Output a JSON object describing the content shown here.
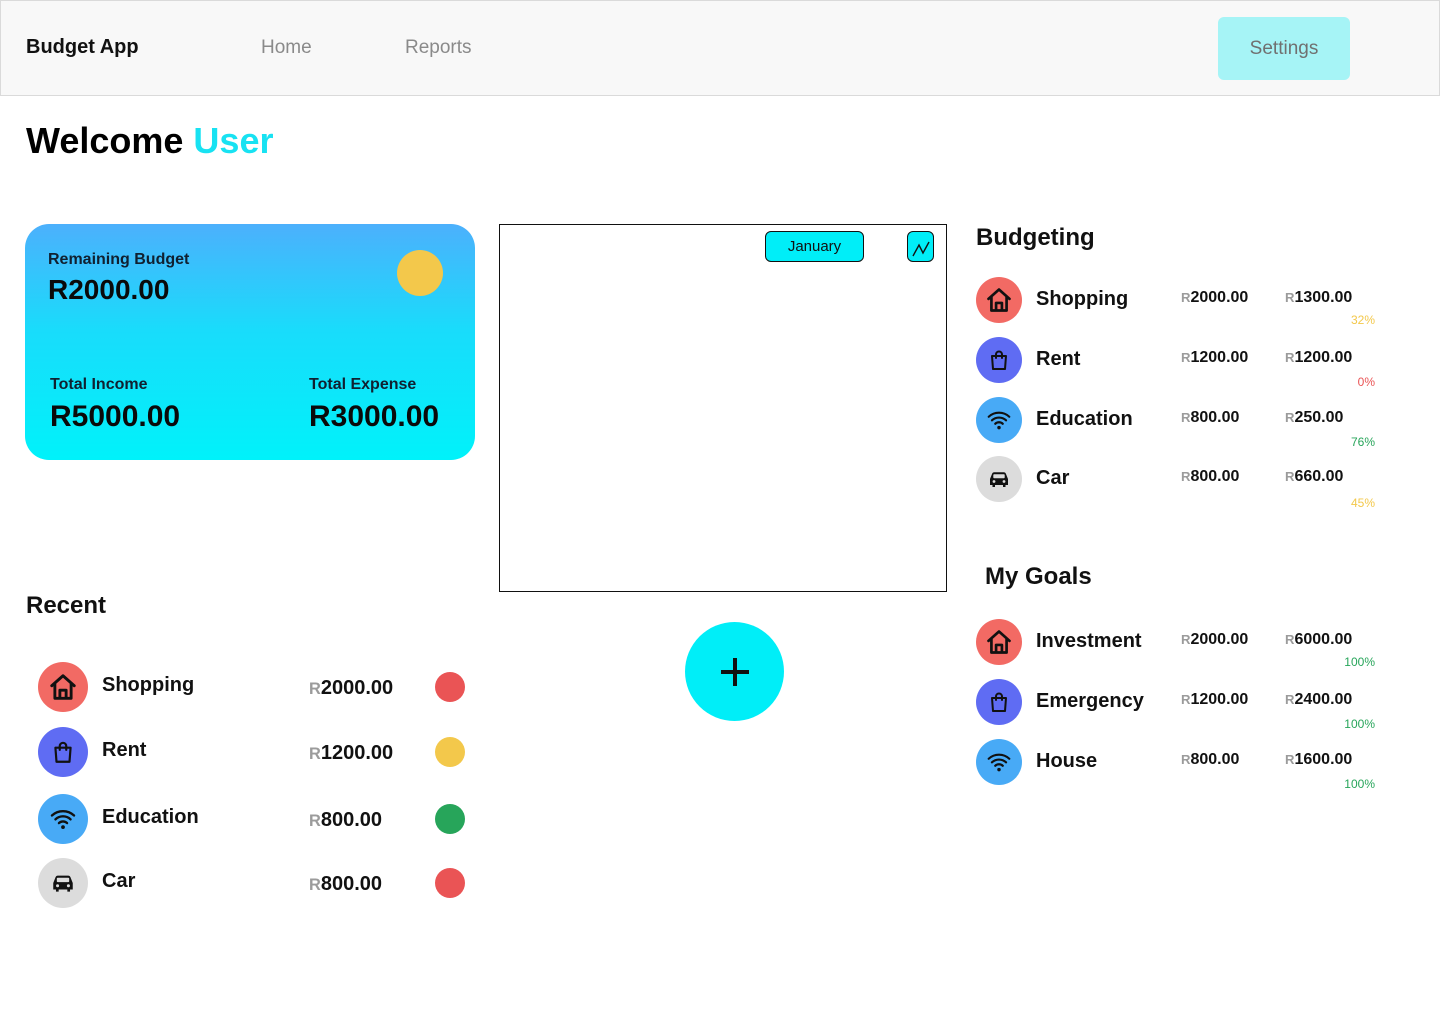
{
  "nav": {
    "brand": "Budget App",
    "links": [
      "Home",
      "Reports"
    ],
    "settings_label": "Settings"
  },
  "welcome": {
    "greeting": "Welcome",
    "user": "User"
  },
  "balance": {
    "remaining_label": "Remaining Budget",
    "remaining_value": "R2000.00",
    "income_label": "Total Income",
    "income_value": "R5000.00",
    "expense_label": "Total Expense",
    "expense_value": "R3000.00"
  },
  "chart_panel": {
    "month": "January"
  },
  "recent": {
    "title": "Recent",
    "items": [
      {
        "name": "Shopping",
        "currency": "R",
        "amount": "2000.00",
        "icon": "house-icon",
        "icon_color": "#f26a64",
        "status_color": "#ea5455"
      },
      {
        "name": "Rent",
        "currency": "R",
        "amount": "1200.00",
        "icon": "shopping-bag-icon",
        "icon_color": "#5f6cf3",
        "status_color": "#f3c84b"
      },
      {
        "name": "Education",
        "currency": "R",
        "amount": "800.00",
        "icon": "wifi-icon",
        "icon_color": "#48aaf6",
        "status_color": "#27a55a"
      },
      {
        "name": "Car",
        "currency": "R",
        "amount": "800.00",
        "icon": "car-icon",
        "icon_color": "#dcdcdc",
        "status_color": "#ea5455"
      }
    ]
  },
  "budgeting": {
    "title": "Budgeting",
    "items": [
      {
        "name": "Shopping",
        "currency": "R",
        "spent": "2000.00",
        "limit": "1300.00",
        "percent": "32%",
        "percent_color": "#f3c84b",
        "icon": "house-icon"
      },
      {
        "name": "Rent",
        "currency": "R",
        "spent": "1200.00",
        "limit": "1200.00",
        "percent": "0%",
        "percent_color": "#ea5455",
        "icon": "shopping-bag-icon"
      },
      {
        "name": "Education",
        "currency": "R",
        "spent": "800.00",
        "limit": "250.00",
        "percent": "76%",
        "percent_color": "#27a55a",
        "icon": "wifi-icon"
      },
      {
        "name": "Car",
        "currency": "R",
        "spent": "800.00",
        "limit": "660.00",
        "percent": "45%",
        "percent_color": "#f3c84b",
        "icon": "car-icon"
      }
    ]
  },
  "goals": {
    "title": "My Goals",
    "items": [
      {
        "name": "Investment",
        "currency": "R",
        "saved": "2000.00",
        "target": "6000.00",
        "percent": "100%",
        "percent_color": "#27a55a",
        "icon": "house-icon"
      },
      {
        "name": "Emergency",
        "currency": "R",
        "saved": "1200.00",
        "target": "2400.00",
        "percent": "100%",
        "percent_color": "#27a55a",
        "icon": "shopping-bag-icon"
      },
      {
        "name": "House",
        "currency": "R",
        "saved": "800.00",
        "target": "1600.00",
        "percent": "100%",
        "percent_color": "#27a55a",
        "icon": "wifi-icon"
      }
    ]
  }
}
